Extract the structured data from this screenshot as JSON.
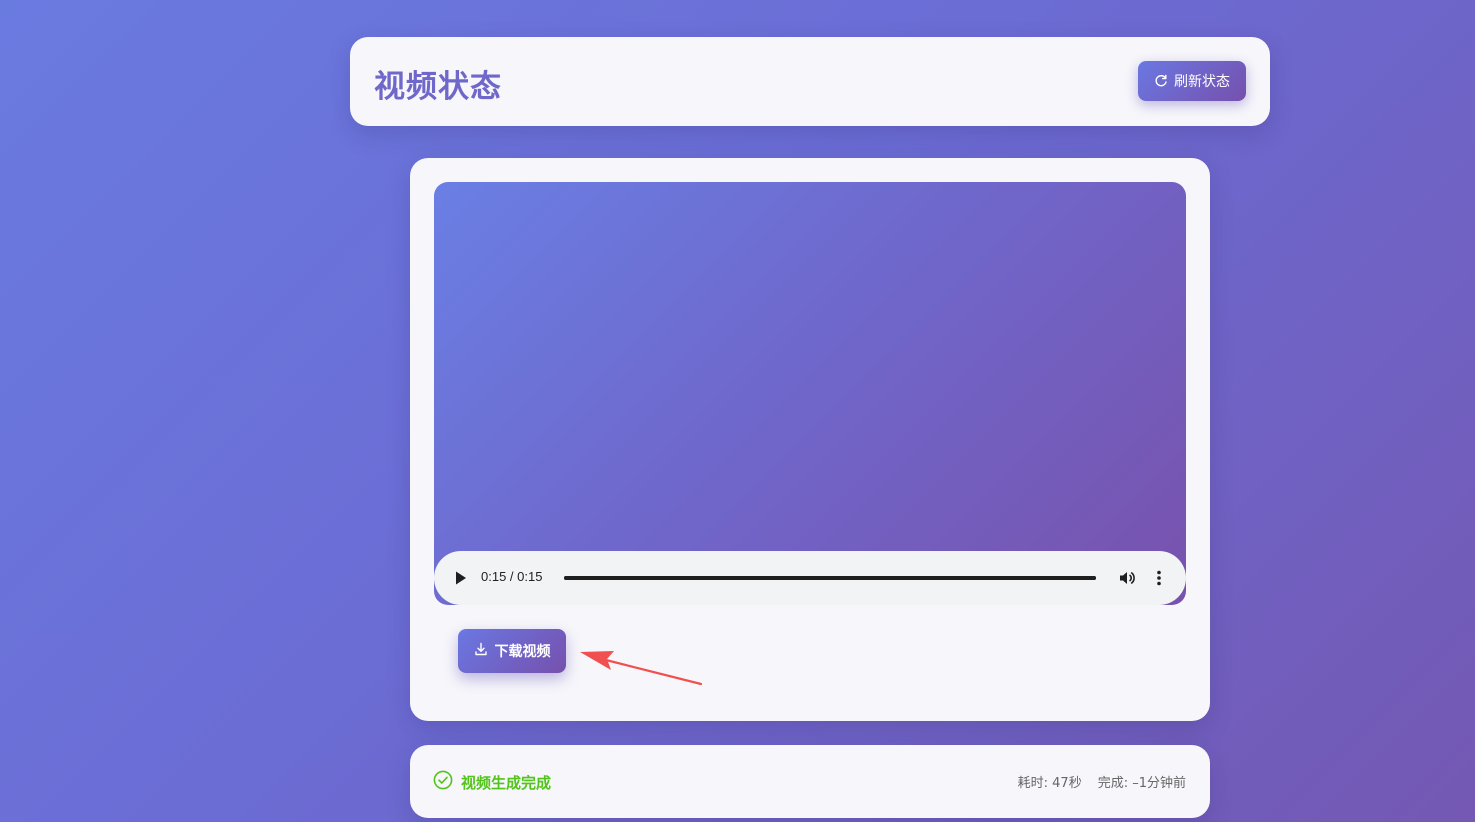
{
  "header": {
    "title": "视频状态",
    "refresh_label": "刷新状态"
  },
  "player": {
    "time_display": "0:15 / 0:15",
    "progress_fraction": 1.0
  },
  "actions": {
    "download_label": "下载视频"
  },
  "status": {
    "message": "视频生成完成",
    "elapsed": "耗时: 47秒",
    "completed": "完成: –1分钟前"
  },
  "icons": {
    "refresh": "refresh-icon",
    "download": "download-icon",
    "success": "check-circle-icon",
    "play": "play-icon",
    "volume": "volume-icon",
    "more": "more-vertical-icon",
    "annotation": "red-arrow-annotation"
  },
  "colors": {
    "accent_start": "#6a78e2",
    "accent_end": "#7650ad",
    "title": "#6f67c9",
    "success": "#52c41a",
    "annotation": "#f0504f"
  }
}
